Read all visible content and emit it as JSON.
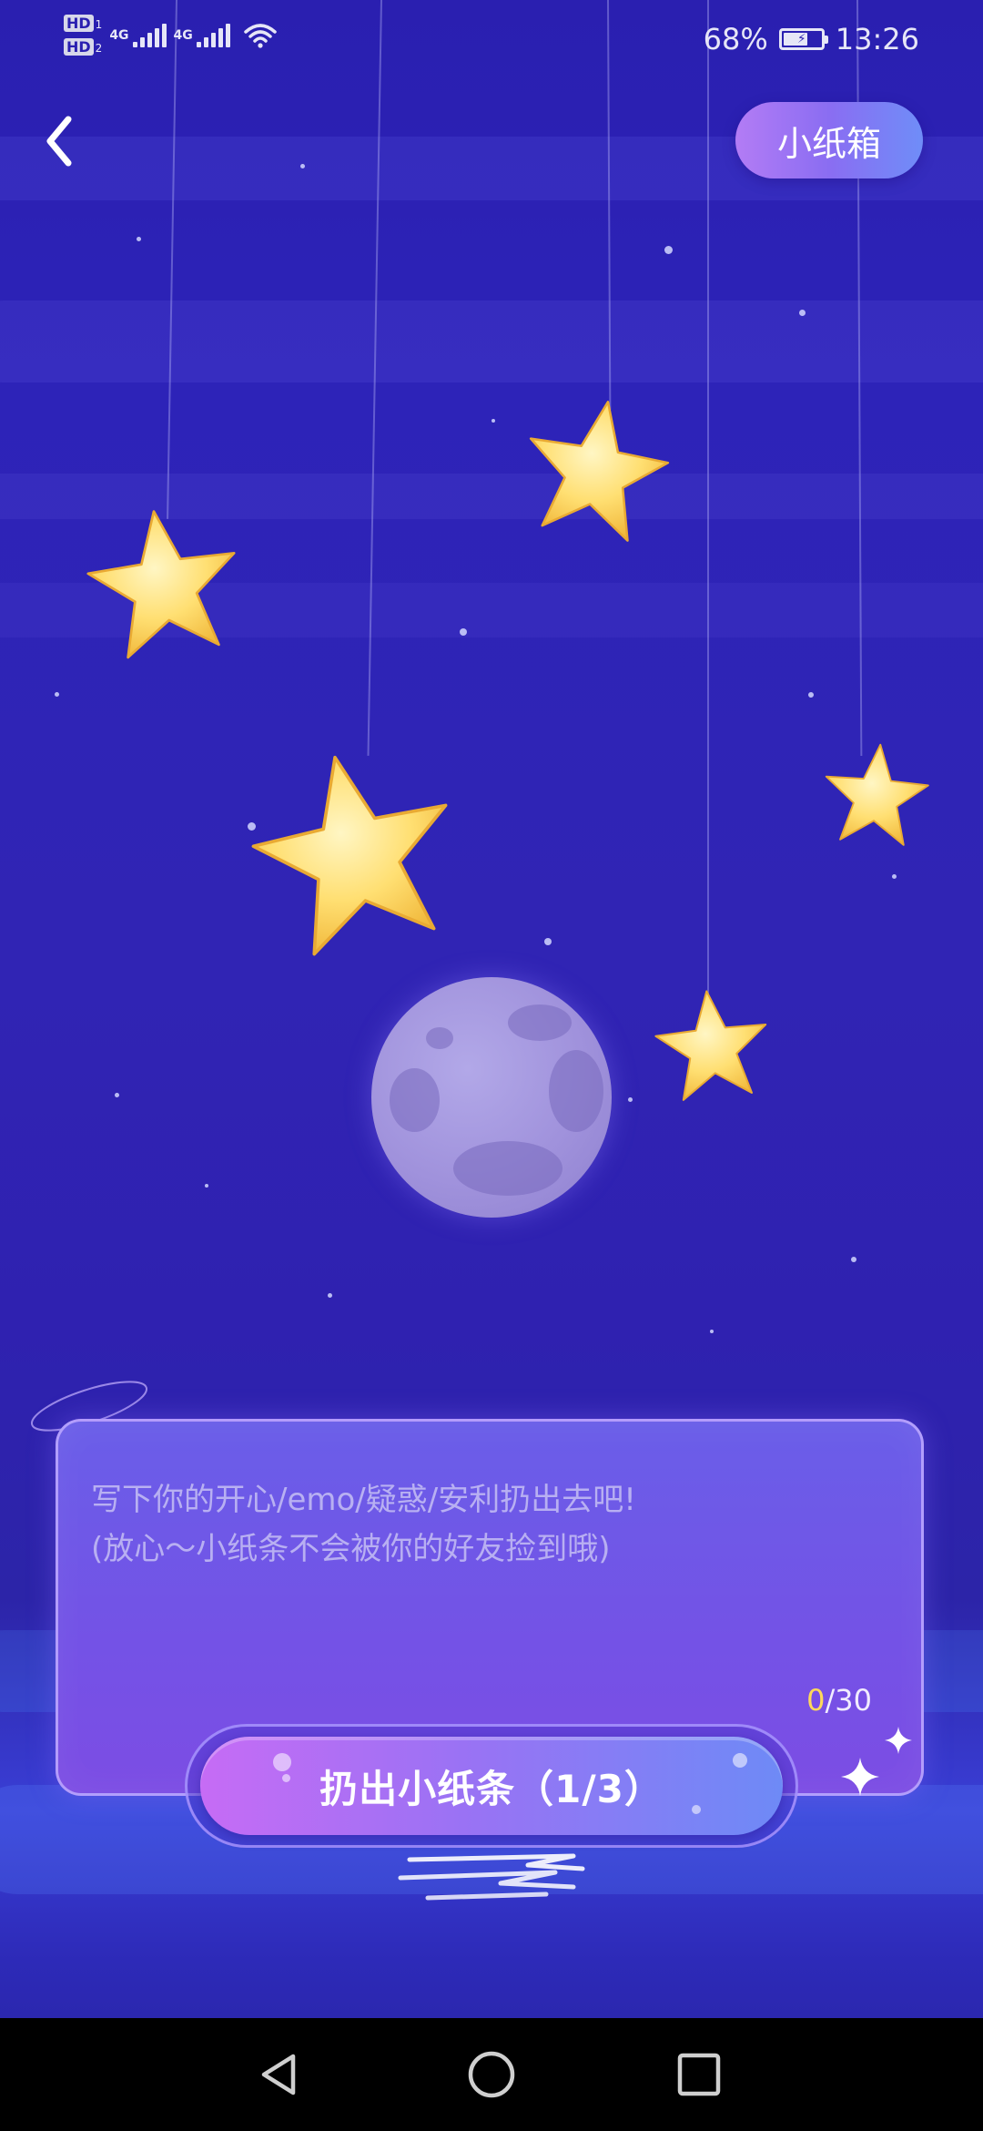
{
  "status_bar": {
    "sim1": "HD",
    "sim1_index": "1",
    "sim2": "HD",
    "sim2_index": "2",
    "network1": "4G",
    "network2": "4G",
    "battery": "68%",
    "battery_level": 0.68,
    "time": "13:26",
    "icons": [
      "signal-icon",
      "signal-icon",
      "wifi-icon",
      "battery-icon"
    ]
  },
  "header": {
    "back_icon": "chevron-left-icon",
    "box_button_label": "小纸箱"
  },
  "scene": {
    "stars": [
      "star-icon",
      "star-icon",
      "star-icon",
      "star-icon",
      "star-icon",
      "star-icon"
    ],
    "moon": "moon-icon",
    "crescent": "crescent-moon-icon"
  },
  "paper": {
    "placeholder": "写下你的开心/emo/疑惑/安利扔出去吧!\n(放心～小纸条不会被你的好友捡到哦)",
    "value": "",
    "counter_current": "0",
    "counter_max": "/30"
  },
  "throw_button": {
    "label": "扔出小纸条（1/3）"
  },
  "nav_bar": {
    "back_icon": "triangle-back-icon",
    "home_icon": "circle-home-icon",
    "recents_icon": "square-recents-icon"
  },
  "colors": {
    "background": "#2d23b8",
    "accent_purple": "#b37cf5",
    "accent_blue": "#6f8df8",
    "counter_highlight": "#ffd95a",
    "star_yellow": "#ffd866"
  }
}
